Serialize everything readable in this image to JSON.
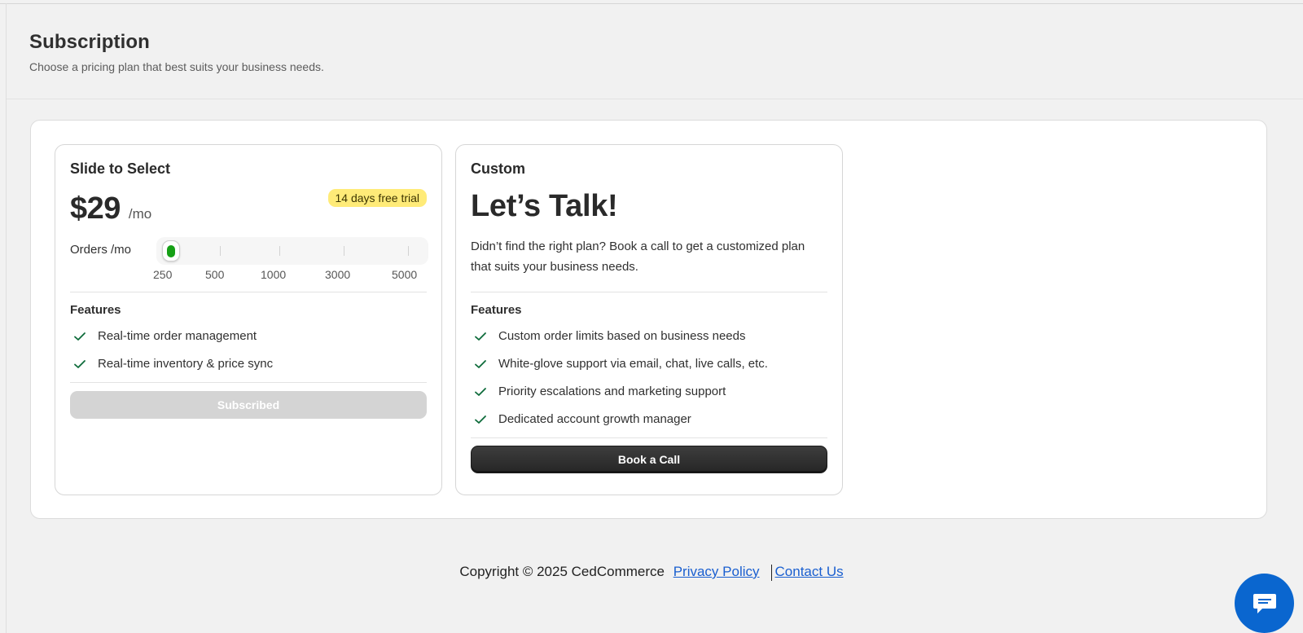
{
  "header": {
    "title": "Subscription",
    "subtitle": "Choose a pricing plan that best suits your business needs."
  },
  "plans": [
    {
      "name": "Slide to Select",
      "price": "$29",
      "period": "/mo",
      "badge": "14 days free trial",
      "slider": {
        "label": "Orders /mo",
        "options": [
          "250",
          "500",
          "1000",
          "3000",
          "5000"
        ],
        "selected": "250"
      },
      "features_title": "Features",
      "features": [
        "Real-time order management",
        "Real-time inventory & price sync"
      ],
      "button_label": "Subscribed"
    },
    {
      "name": "Custom",
      "headline": "Let’s Talk!",
      "description": "Didn’t find the right plan? Book a call to get a customized plan that suits your business needs.",
      "features_title": "Features",
      "features": [
        "Custom order limits based on business needs",
        "White-glove support via email, chat, live calls, etc.",
        "Priority escalations and marketing support",
        "Dedicated account growth manager"
      ],
      "button_label": "Book a Call"
    }
  ],
  "footer": {
    "copyright": "Copyright © 2025 CedCommerce",
    "privacy_label": "Privacy Policy",
    "contact_label": "Contact Us"
  },
  "colors": {
    "accent_green": "#16a016",
    "badge_yellow": "#ffeb78",
    "link_blue": "#1a5fd0",
    "chat_blue": "#0a66cf"
  },
  "icons": {
    "feature_check": "check-icon",
    "chat": "chat-icon"
  }
}
